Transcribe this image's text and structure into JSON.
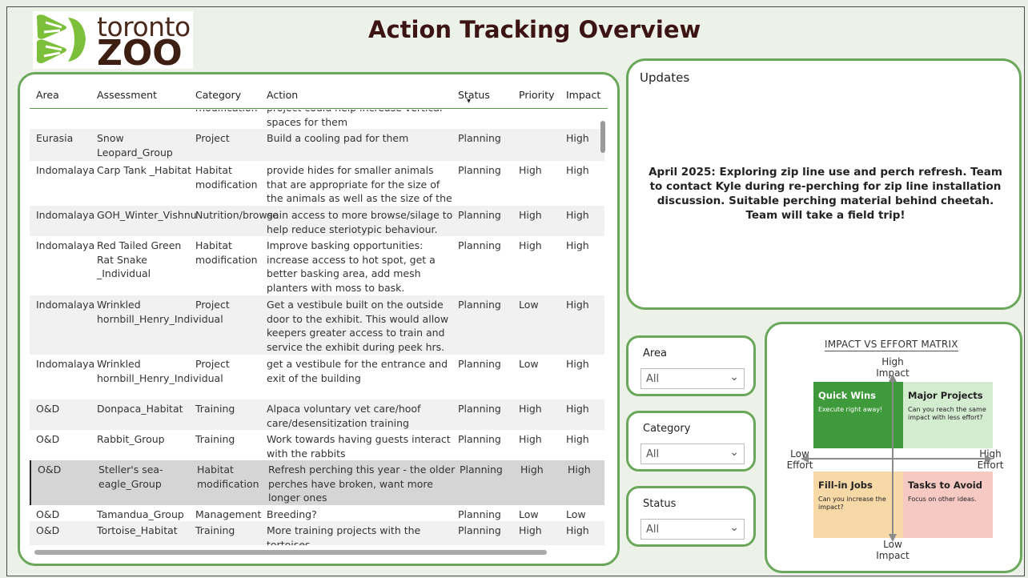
{
  "header": {
    "logo_line1": "toronto",
    "logo_line2": "ZOO",
    "title": "Action Tracking Overview"
  },
  "table": {
    "columns": [
      "Area",
      "Assessment",
      "Category",
      "Action",
      "Status",
      "Priority",
      "Impact"
    ],
    "sort_indicator": "▾",
    "partial_top_row": {
      "category": "modification",
      "action": "project could help increase vertical spaces for them"
    },
    "rows": [
      {
        "area": "Eurasia",
        "assessment": "Snow Leopard_Group",
        "category": "Project",
        "action": "Build a cooling pad for them",
        "status": "Planning",
        "priority": "",
        "impact": "High"
      },
      {
        "area": "Indomalaya",
        "assessment": "Carp Tank _Habitat",
        "category": "Habitat modification",
        "action": "provide hides for smaller animals that are appropriate for the size of the animals as well as the size of the tank.",
        "status": "Planning",
        "priority": "High",
        "impact": "High"
      },
      {
        "area": "Indomalaya",
        "assessment": "GOH_Winter_Vishnu",
        "category": "Nutrition/browse",
        "action": "gain access to more browse/silage to help reduce steriotypic behaviour.",
        "status": "Planning",
        "priority": "High",
        "impact": "High"
      },
      {
        "area": "Indomalaya",
        "assessment": "Red Tailed Green Rat Snake _Individual",
        "category": "Habitat modification",
        "action": "Improve basking opportunities: increase access to hot spot, get a better basking area, add mesh planters with moss to bask.",
        "status": "Planning",
        "priority": "High",
        "impact": "High"
      },
      {
        "area": "Indomalaya",
        "assessment": "Wrinkled hornbill_Henry_Individual",
        "category": "Project",
        "action": "Get a vestibule built on the outside door to the exhibit. This would allow keepers greater access to train and service the exhibit during peek hrs.",
        "status": "Planning",
        "priority": "Low",
        "impact": "High"
      },
      {
        "area": "Indomalaya",
        "assessment": "Wrinkled hornbill_Henry_Individual",
        "category": "Project",
        "action": "get a vestibule for the entrance and exit of the building",
        "status": "Planning",
        "priority": "Low",
        "impact": "High"
      },
      {
        "area": "O&D",
        "assessment": "Donpaca_Habitat",
        "category": "Training",
        "action": "Alpaca voluntary vet care/hoof care/desensitization training",
        "status": "Planning",
        "priority": "High",
        "impact": "High"
      },
      {
        "area": "O&D",
        "assessment": "Rabbit_Group",
        "category": "Training",
        "action": "Work towards having guests interact with the rabbits",
        "status": "Planning",
        "priority": "High",
        "impact": "High"
      },
      {
        "area": "O&D",
        "assessment": "Steller's sea-eagle_Group",
        "category": "Habitat modification",
        "action": "Refresh perching this year - the older perches have broken, want more longer ones",
        "status": "Planning",
        "priority": "High",
        "impact": "High"
      },
      {
        "area": "O&D",
        "assessment": "Tamandua_Group",
        "category": "Management",
        "action": "Breeding?",
        "status": "Planning",
        "priority": "Low",
        "impact": "Low"
      },
      {
        "area": "O&D",
        "assessment": "Tortoise_Habitat",
        "category": "Training",
        "action": "More training projects with the tortoises",
        "status": "Planning",
        "priority": "High",
        "impact": "High"
      }
    ]
  },
  "updates": {
    "label": "Updates",
    "text": "April 2025: Exploring zip line use and perch refresh. Team to contact Kyle during re-perching for zip line installation discussion. Suitable perching material behind cheetah. Team will take a field trip!"
  },
  "slicers": [
    {
      "label": "Area",
      "value": "All"
    },
    {
      "label": "Category",
      "value": "All"
    },
    {
      "label": "Status",
      "value": "All"
    }
  ],
  "matrix": {
    "title": "IMPACT VS EFFORT MATRIX",
    "high_impact": "High Impact",
    "low_impact": "Low Impact",
    "low_effort": "Low Effort",
    "high_effort": "High Effort",
    "quadrants": [
      {
        "title": "Quick Wins",
        "sub": "Execute right away!",
        "color": "#3f9a3b"
      },
      {
        "title": "Major Projects",
        "sub": "Can you reach the same impact with less effort?",
        "color": "#d3ecd0"
      },
      {
        "title": "Fill-in Jobs",
        "sub": "Can you increase the impact?",
        "color": "#f7d9a8"
      },
      {
        "title": "Tasks to Avoid",
        "sub": "Focus on other ideas.",
        "color": "#f6c9c2"
      }
    ]
  }
}
